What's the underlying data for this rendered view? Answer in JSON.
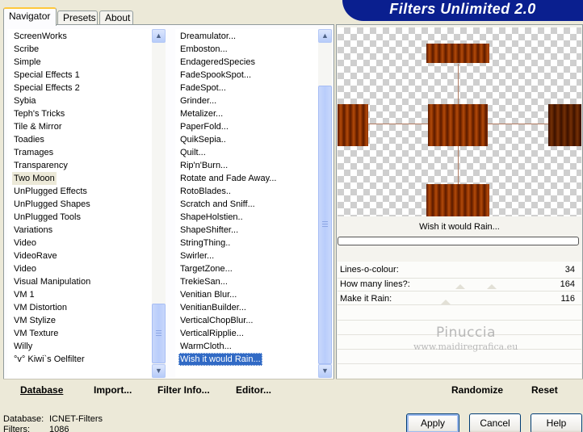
{
  "banner": {
    "title": "Filters Unlimited 2.0"
  },
  "tabs": [
    "Navigator",
    "Presets",
    "About"
  ],
  "category_list": [
    "ScreenWorks",
    "Scribe",
    "Simple",
    "Special Effects 1",
    "Special Effects 2",
    "Sybia",
    "Teph's Tricks",
    "Tile & Mirror",
    "Toadies",
    "Tramages",
    "Transparency",
    "Two Moon",
    "UnPlugged Effects",
    "UnPlugged Shapes",
    "UnPlugged Tools",
    "Variations",
    "Video",
    "VideoRave",
    "Video",
    "Visual Manipulation",
    "VM 1",
    "VM Distortion",
    "VM Stylize",
    "VM Texture",
    "Willy",
    "°v° Kiwi`s Oelfilter"
  ],
  "filter_list": [
    "Dreamulator...",
    "Emboston...",
    "EndageredSpecies",
    "FadeSpookSpot...",
    "FadeSpot...",
    "Grinder...",
    "Metalizer...",
    "PaperFold...",
    "QuikSepia..",
    "Quilt...",
    "Rip'n'Burn...",
    "Rotate and Fade Away...",
    "RotoBlades..",
    "Scratch and Sniff...",
    "ShapeHolstien..",
    "ShapeShifter...",
    "StringThing..",
    "Swirler...",
    "TargetZone...",
    "TrekieSan...",
    "Venitian Blur...",
    "VenitianBuilder...",
    "VerticalChopBlur...",
    "VerticalRipplie...",
    "WarmCloth...",
    "Wish it would Rain..."
  ],
  "left_buttons": {
    "database": "Database",
    "import": "Import...",
    "filter_info": "Filter Info...",
    "editor": "Editor..."
  },
  "preview": {
    "filter_name": "Wish it would Rain..."
  },
  "parameters": [
    {
      "label": "Lines-o-colour:",
      "value": "34"
    },
    {
      "label": "How many lines?:",
      "value": "164"
    },
    {
      "label": "Make it Rain:",
      "value": "116"
    }
  ],
  "watermark": {
    "line1": "Pinuccia",
    "line2": "www.maidiregrafica.eu"
  },
  "right_buttons": {
    "randomize": "Randomize",
    "reset": "Reset"
  },
  "status": {
    "database_label": "Database:",
    "database_value": "ICNET-Filters",
    "filters_label": "Filters:",
    "filters_value": "1086"
  },
  "dialog_buttons": {
    "apply": "Apply",
    "cancel": "Cancel",
    "help": "Help"
  },
  "colors": {
    "banner": "#0a1f8f",
    "selection": "#316ac5",
    "wood": "#8a3100"
  },
  "icons": [
    "scroll-up-icon",
    "scroll-down-icon",
    "scroll-grip-icon"
  ]
}
